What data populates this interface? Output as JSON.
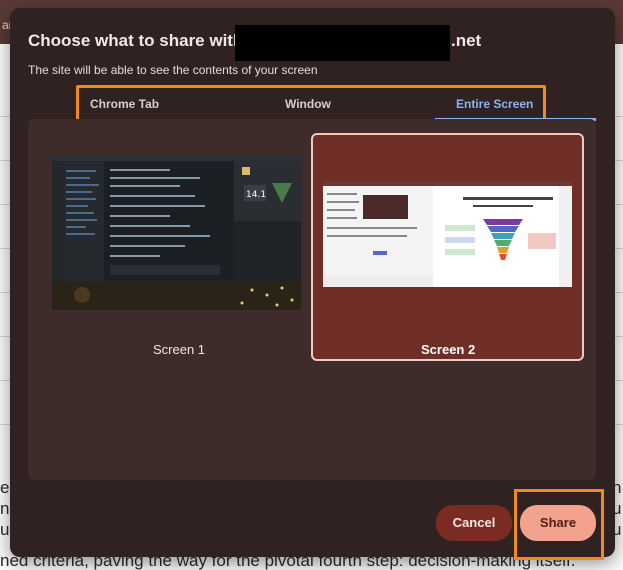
{
  "background_page": {
    "topbar_text": "ar",
    "para_left_chars": [
      "e",
      "n",
      "u"
    ],
    "para_right_chars": [
      "n",
      "u",
      "u"
    ],
    "bottom_line": "ned criteria, paving the way for the pivotal fourth step: decision-making itself."
  },
  "dialog": {
    "title": "Choose what to share with",
    "title_suffix": ".net",
    "subtitle": "The site will be able to see the contents of your screen",
    "tabs": [
      {
        "label": "Chrome Tab"
      },
      {
        "label": "Window"
      },
      {
        "label": "Entire Screen"
      }
    ],
    "screens": [
      {
        "label": "Screen 1"
      },
      {
        "label": "Screen 2"
      }
    ],
    "buttons": {
      "cancel": "Cancel",
      "share": "Share"
    }
  },
  "colors": {
    "dialog_bg": "#2f2220",
    "selected_tab": "#8ab4f8",
    "annotation_highlight": "#f08a1c",
    "selected_card": "#6f2e26",
    "share_button": "#f3a28e",
    "cancel_button": "#7a2c22"
  }
}
